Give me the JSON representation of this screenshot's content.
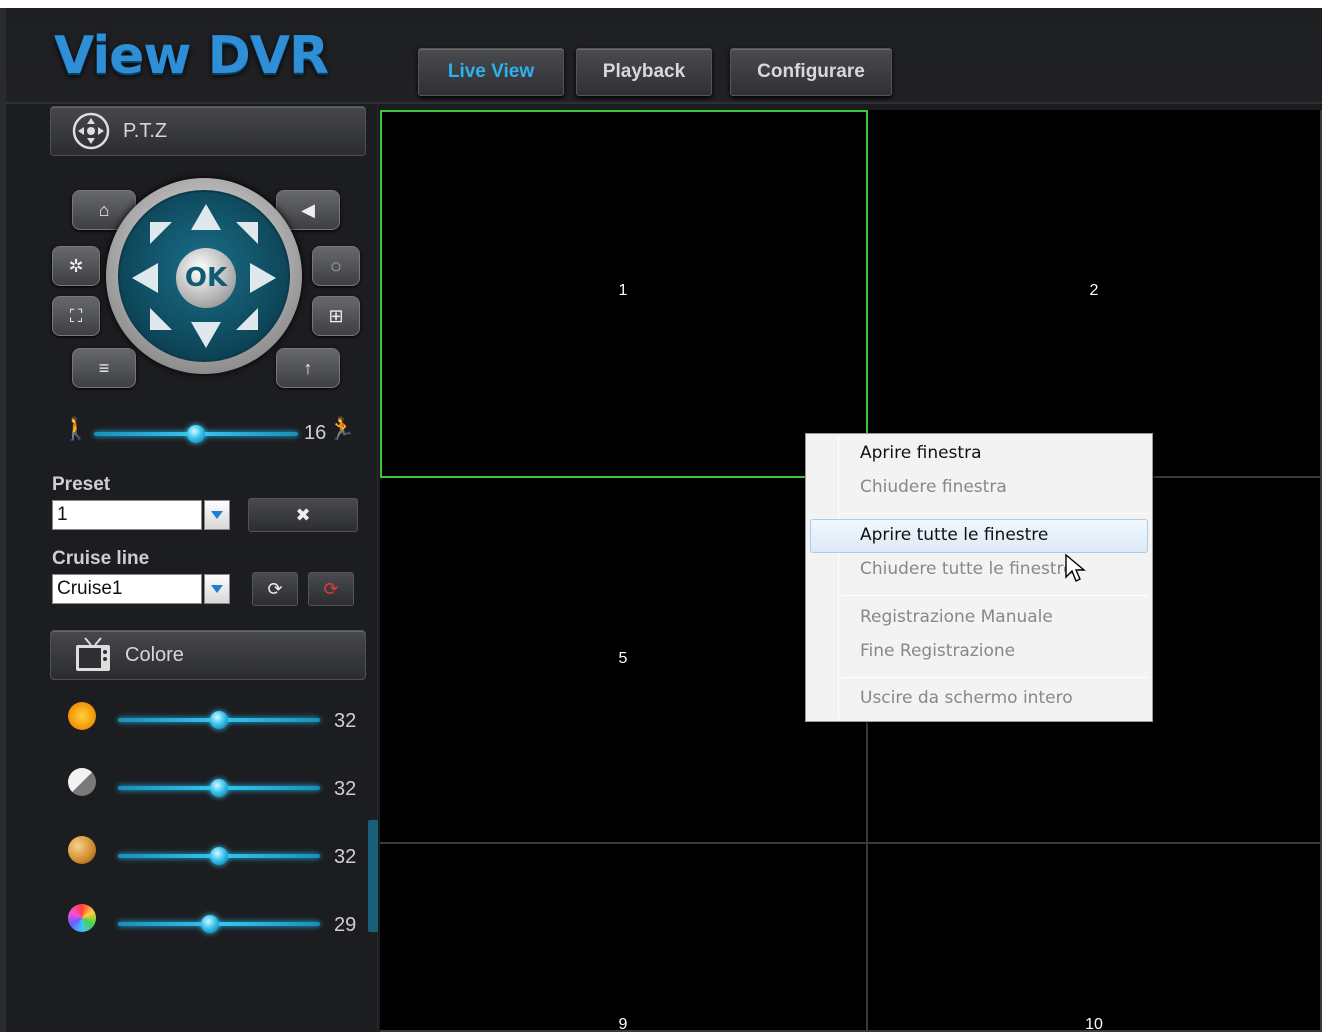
{
  "app": {
    "logo_text": "View DVR"
  },
  "nav": {
    "tabs": [
      {
        "label": "Live View"
      },
      {
        "label": "Playback"
      },
      {
        "label": "Configurare"
      }
    ]
  },
  "ptz": {
    "title": "P.T.Z",
    "ok_label": "OK",
    "speed_value": "16",
    "speed_level": 0.5
  },
  "preset": {
    "label": "Preset",
    "value": "1"
  },
  "cruise": {
    "label": "Cruise line",
    "value": "Cruise1"
  },
  "color": {
    "title": "Colore",
    "sliders": [
      {
        "name": "brightness",
        "value": "32",
        "level": 0.5
      },
      {
        "name": "contrast",
        "value": "32",
        "level": 0.5
      },
      {
        "name": "saturation",
        "value": "32",
        "level": 0.5
      },
      {
        "name": "hue",
        "value": "29",
        "level": 0.45
      }
    ]
  },
  "grid": {
    "cells": [
      {
        "label": "1",
        "selected": true
      },
      {
        "label": "2",
        "selected": false
      },
      {
        "label": "5",
        "selected": false
      },
      {
        "label": "",
        "selected": false
      },
      {
        "label": "9",
        "selected": false
      },
      {
        "label": "10",
        "selected": false
      }
    ]
  },
  "context_menu": {
    "items": [
      {
        "label": "Aprire finestra",
        "enabled": true
      },
      {
        "label": "Chiudere finestra",
        "enabled": false
      },
      {
        "label": "Aprire tutte le finestre",
        "enabled": true,
        "highlighted": true
      },
      {
        "label": "Chiudere tutte le finestre",
        "enabled": false
      },
      {
        "label": "Registrazione Manuale",
        "enabled": false
      },
      {
        "label": "Fine Registrazione",
        "enabled": false
      },
      {
        "label": "Uscire da schermo intero",
        "enabled": false
      }
    ]
  },
  "colors": {
    "accent_blue": "#2eb2ee",
    "selected_border": "#3cc63c",
    "background": "#1b1c1e"
  }
}
